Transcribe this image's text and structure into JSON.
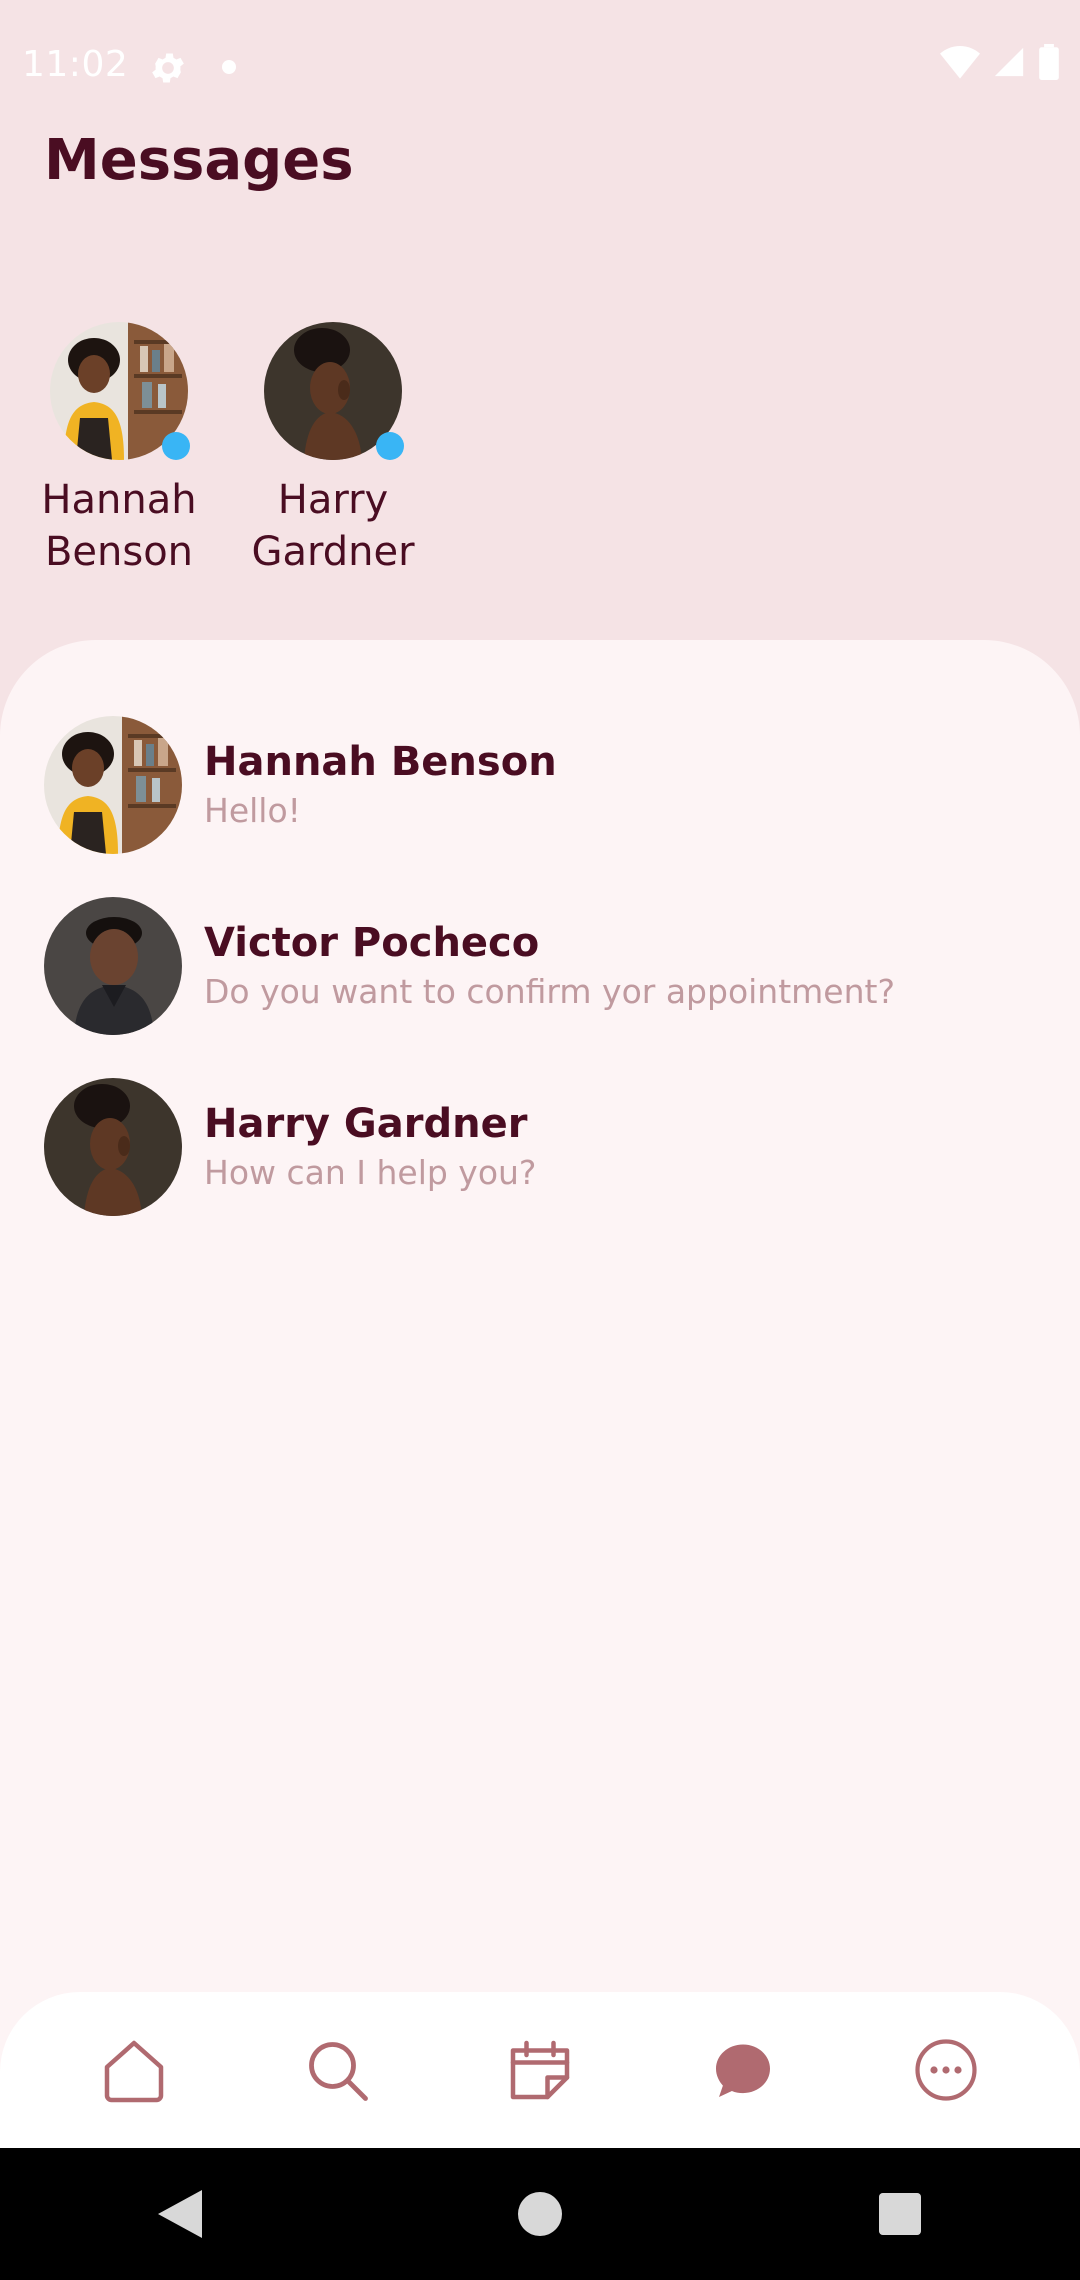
{
  "status_bar": {
    "time": "11:02"
  },
  "header": {
    "title": "Messages"
  },
  "online_contacts": [
    {
      "name": "Hannah Benson",
      "avatar": "hannah"
    },
    {
      "name": "Harry Gardner",
      "avatar": "harry"
    }
  ],
  "conversations": [
    {
      "name": "Hannah Benson",
      "preview": "Hello!",
      "avatar": "hannah"
    },
    {
      "name": "Victor Pocheco",
      "preview": "Do you want to confirm yor appointment?",
      "avatar": "victor"
    },
    {
      "name": "Harry Gardner",
      "preview": "How can I help you?",
      "avatar": "harry"
    }
  ],
  "bottom_nav": [
    {
      "icon": "home-icon",
      "active": false
    },
    {
      "icon": "search-icon",
      "active": false
    },
    {
      "icon": "calendar-icon",
      "active": false
    },
    {
      "icon": "chat-bubble-icon",
      "active": true
    },
    {
      "icon": "more-icon",
      "active": false
    }
  ],
  "colors": {
    "background": "#f5e3e5",
    "sheet": "#fdf4f5",
    "title": "#4a0d22",
    "preview": "#c09a9f",
    "online_dot": "#39b5f5",
    "nav_icon": "#b06a70"
  }
}
